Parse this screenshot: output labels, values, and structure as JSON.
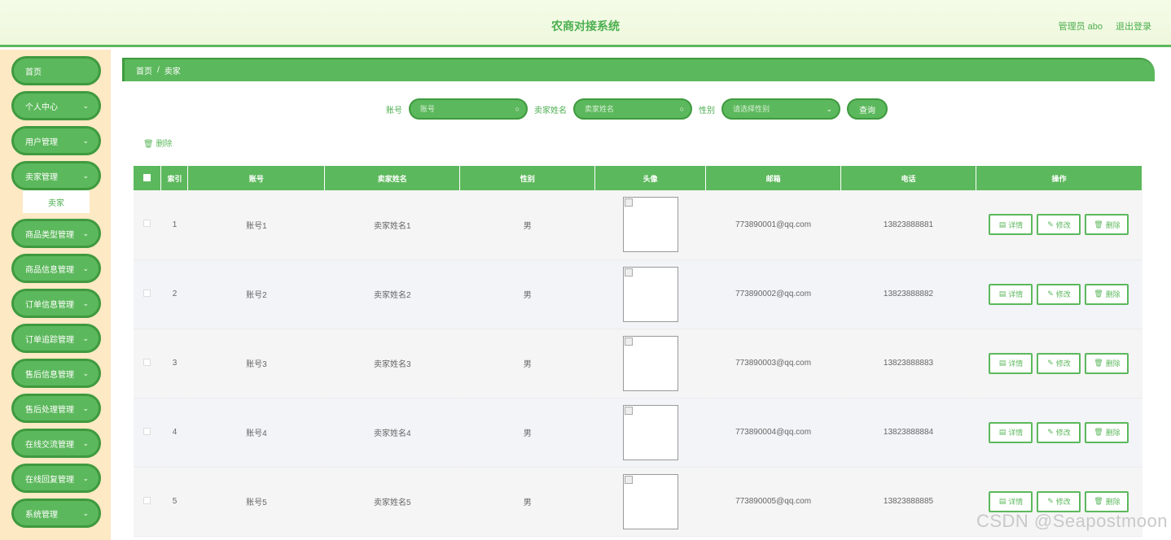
{
  "header": {
    "title": "农商对接系统",
    "user": "管理员 abo",
    "logout": "退出登录"
  },
  "sidebar": {
    "items": [
      {
        "label": "首页",
        "chevron": false
      },
      {
        "label": "个人中心",
        "chevron": true
      },
      {
        "label": "用户管理",
        "chevron": true
      },
      {
        "label": "卖家管理",
        "chevron": true
      },
      {
        "label": "商品类型管理",
        "chevron": true
      },
      {
        "label": "商品信息管理",
        "chevron": true
      },
      {
        "label": "订单信息管理",
        "chevron": true
      },
      {
        "label": "订单追踪管理",
        "chevron": true
      },
      {
        "label": "售后信息管理",
        "chevron": true
      },
      {
        "label": "售后处理管理",
        "chevron": true
      },
      {
        "label": "在线交流管理",
        "chevron": true
      },
      {
        "label": "在线回复管理",
        "chevron": true
      },
      {
        "label": "系统管理",
        "chevron": true
      }
    ],
    "sub_item": "卖家"
  },
  "breadcrumb": {
    "home": "首页",
    "sep": "/",
    "current": "卖家"
  },
  "search": {
    "account_label": "账号",
    "account_placeholder": "账号",
    "name_label": "卖家姓名",
    "name_placeholder": "卖家姓名",
    "gender_label": "性别",
    "gender_placeholder": "请选择性别",
    "query": "查询"
  },
  "bulk_delete": "删除",
  "table": {
    "headers": [
      "索引",
      "账号",
      "卖家姓名",
      "性别",
      "头像",
      "邮箱",
      "电话",
      "操作"
    ],
    "rows": [
      {
        "index": "1",
        "account": "账号1",
        "name": "卖家姓名1",
        "gender": "男",
        "email": "773890001@qq.com",
        "phone": "13823888881"
      },
      {
        "index": "2",
        "account": "账号2",
        "name": "卖家姓名2",
        "gender": "男",
        "email": "773890002@qq.com",
        "phone": "13823888882"
      },
      {
        "index": "3",
        "account": "账号3",
        "name": "卖家姓名3",
        "gender": "男",
        "email": "773890003@qq.com",
        "phone": "13823888883"
      },
      {
        "index": "4",
        "account": "账号4",
        "name": "卖家姓名4",
        "gender": "男",
        "email": "773890004@qq.com",
        "phone": "13823888884"
      },
      {
        "index": "5",
        "account": "账号5",
        "name": "卖家姓名5",
        "gender": "男",
        "email": "773890005@qq.com",
        "phone": "13823888885"
      }
    ],
    "ops": {
      "detail": "详情",
      "edit": "修改",
      "delete": "删除"
    }
  },
  "watermark": "CSDN @Seapostmoon",
  "colors": {
    "primary": "#5cb85c",
    "border": "#3f9a3f",
    "sidebar_bg": "#fde9c4"
  }
}
